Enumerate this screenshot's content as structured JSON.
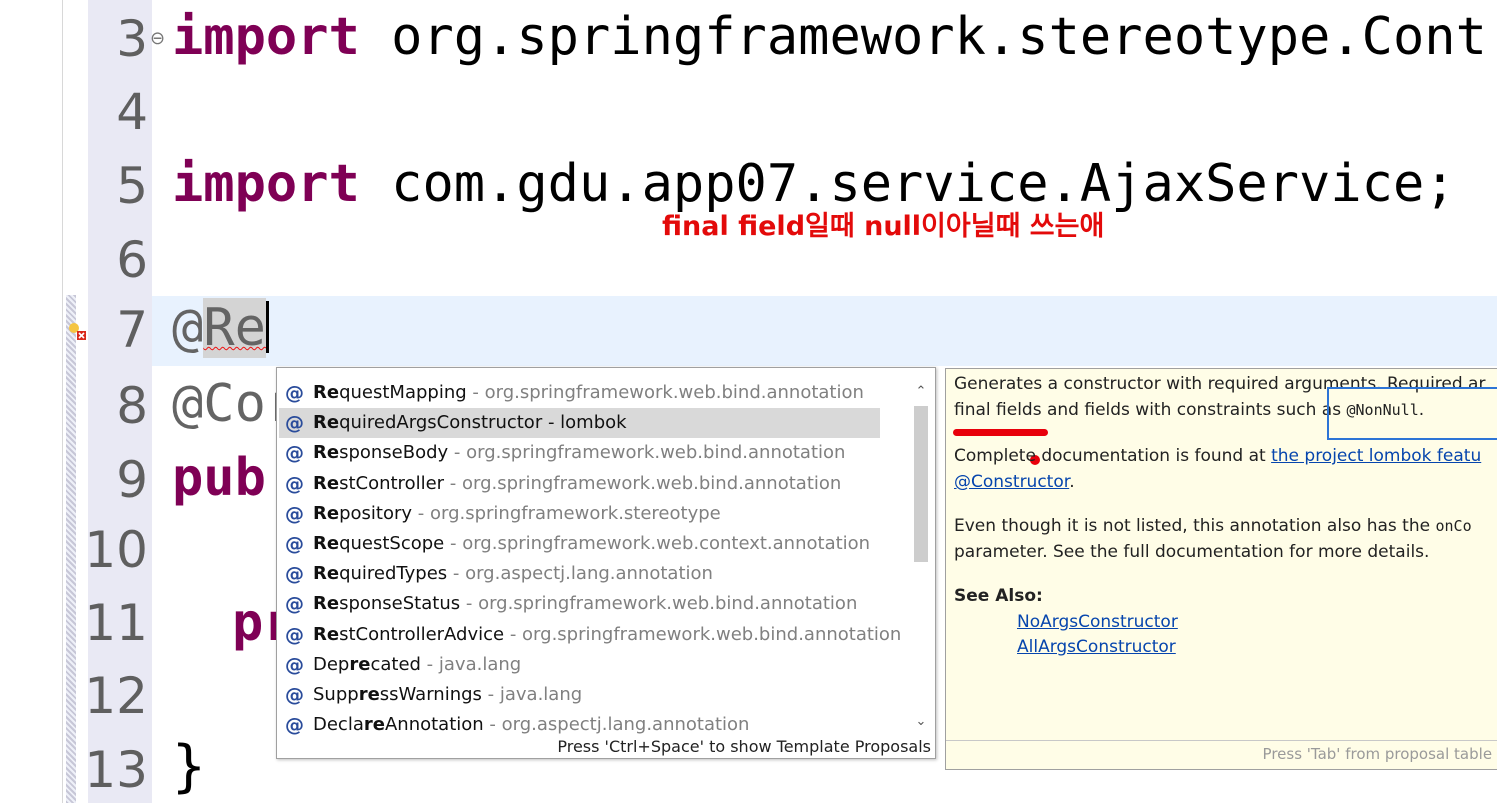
{
  "editor": {
    "lines": [
      {
        "num": "3",
        "kw": "import",
        "text": " org.springframework.stereotype.Cont"
      },
      {
        "num": "4"
      },
      {
        "num": "5",
        "kw": "import",
        "text": " com.gdu.app07.service.AjaxService;"
      },
      {
        "num": "6"
      },
      {
        "num": "7",
        "prefix": "@",
        "typed": "Re"
      },
      {
        "num": "8",
        "text": "@Cor"
      },
      {
        "num": "9",
        "kw": "pub"
      },
      {
        "num": "10"
      },
      {
        "num": "11",
        "kw": "pr"
      },
      {
        "num": "12"
      },
      {
        "num": "13",
        "text": "}"
      }
    ],
    "fold_marker": "⊖"
  },
  "overlay_note": "final field일때 null이아닐때 쓰는애",
  "completion": {
    "proposals": [
      {
        "bold": "Re",
        "rest": "questMapping",
        "pkg": " - org.springframework.web.bind.annotation"
      },
      {
        "bold": "Re",
        "rest": "quiredArgsConstructor",
        "pkg": " - lombok",
        "selected": true
      },
      {
        "bold": "Re",
        "rest": "sponseBody",
        "pkg": " - org.springframework.web.bind.annotation"
      },
      {
        "bold": "Re",
        "rest": "stController",
        "pkg": " - org.springframework.web.bind.annotation"
      },
      {
        "bold": "Re",
        "rest": "pository",
        "pkg": " - org.springframework.stereotype"
      },
      {
        "bold": "Re",
        "rest": "questScope",
        "pkg": " - org.springframework.web.context.annotation"
      },
      {
        "bold": "Re",
        "rest": "quiredTypes",
        "pkg": " - org.aspectj.lang.annotation"
      },
      {
        "bold": "Re",
        "rest": "sponseStatus",
        "pkg": " - org.springframework.web.bind.annotation"
      },
      {
        "bold": "Re",
        "rest": "stControllerAdvice",
        "pkg": " - org.springframework.web.bind.annotation"
      },
      {
        "pre": "Dep",
        "bold": "re",
        "rest": "cated",
        "pkg": " - java.lang"
      },
      {
        "pre": "Supp",
        "bold": "re",
        "rest": "ssWarnings",
        "pkg": " - java.lang"
      },
      {
        "pre": "Decla",
        "bold": "re",
        "rest": "Annotation",
        "pkg": " - org.aspectj.lang.annotation"
      }
    ],
    "status": "Press 'Ctrl+Space' to show Template Proposals",
    "proposal_icon": "@"
  },
  "javadoc": {
    "line1": "Generates a constructor with required arguments. Required ar",
    "line2_pre": "final fields and fields with constraints such as ",
    "line2_code": "@NonNull",
    "line2_post": ".",
    "line3_pre": "Complete documentation is found at ",
    "line3_link": "the project lombok featu",
    "line4_link": "@Constructor",
    "line4_post": ".",
    "line5_pre": "Even though it is not listed, this annotation also has the ",
    "line5_code": "onCo",
    "line6": "parameter. See the full documentation for more details.",
    "see_also": "See Also:",
    "see_links": [
      "NoArgsConstructor",
      "AllArgsConstructor"
    ],
    "footer": "Press 'Tab' from proposal table o"
  },
  "colors": {
    "keyword": "#7f0055",
    "annotation_note": "#e30a0a",
    "selection": "#d9d9d9"
  }
}
